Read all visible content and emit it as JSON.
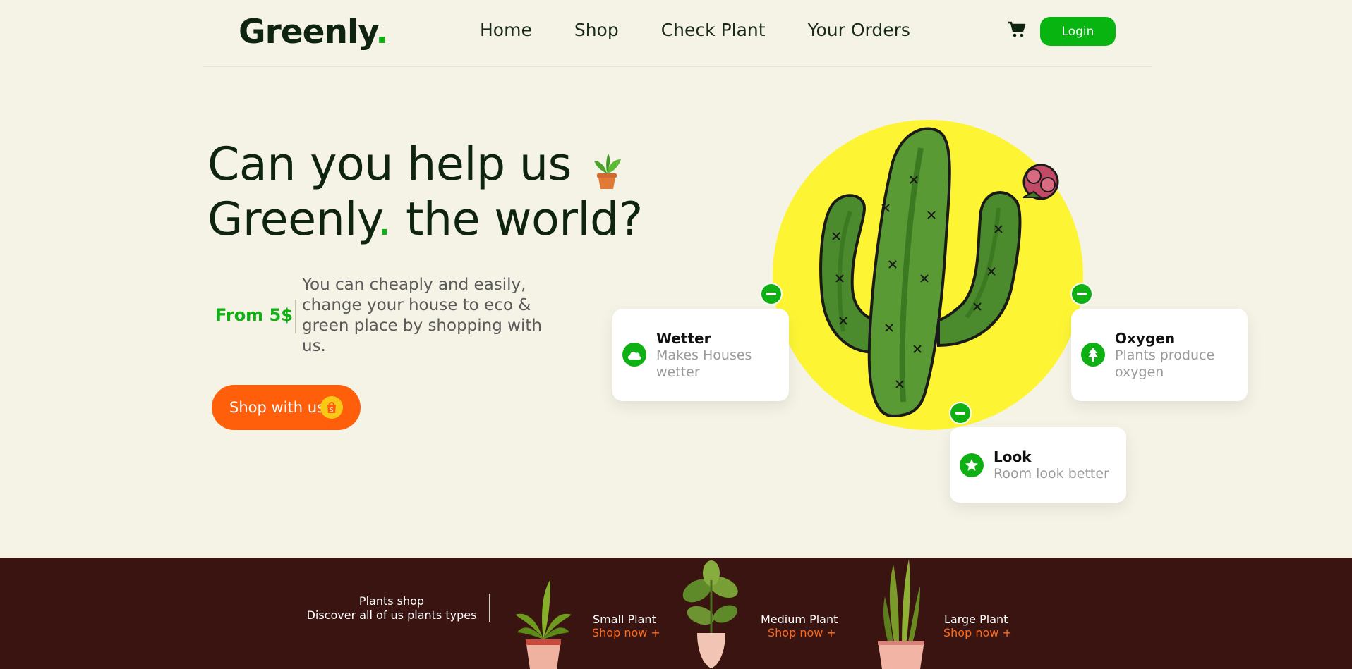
{
  "header": {
    "logo_text": "Greenly",
    "logo_dot": ".",
    "nav": [
      "Home",
      "Shop",
      "Check Plant",
      "Your Orders"
    ],
    "cart_icon": "cart-icon",
    "login_label": "Login"
  },
  "hero": {
    "line1": "Can you help us",
    "line2_brand": "Greenly",
    "line2_dot": ".",
    "line2_rest": " the world?",
    "price": "From 5$",
    "description": "You can cheaply and easily, change your house to eco & green place by shopping with us.",
    "cta_label": "Shop with us"
  },
  "features": [
    {
      "title": "Wetter",
      "subtitle": "Makes Houses wetter",
      "icon": "cloud-icon"
    },
    {
      "title": "Oxygen",
      "subtitle": "Plants produce oxygen",
      "icon": "tree-icon"
    },
    {
      "title": "Look",
      "subtitle": "Room look better",
      "icon": "star-icon"
    }
  ],
  "shop_band": {
    "heading": "Plants shop",
    "subheading": "Discover all of us plants types",
    "categories": [
      {
        "name": "Small Plant",
        "link": "Shop now +"
      },
      {
        "name": "Medium Plant",
        "link": "Shop now +"
      },
      {
        "name": "Large Plant",
        "link": "Shop now +"
      }
    ]
  },
  "colors": {
    "brand_green": "#0fb014",
    "accent_orange": "#ff5e0a",
    "background": "#f5f2e6",
    "band": "#3a1410",
    "sun_yellow": "#fdf534"
  }
}
